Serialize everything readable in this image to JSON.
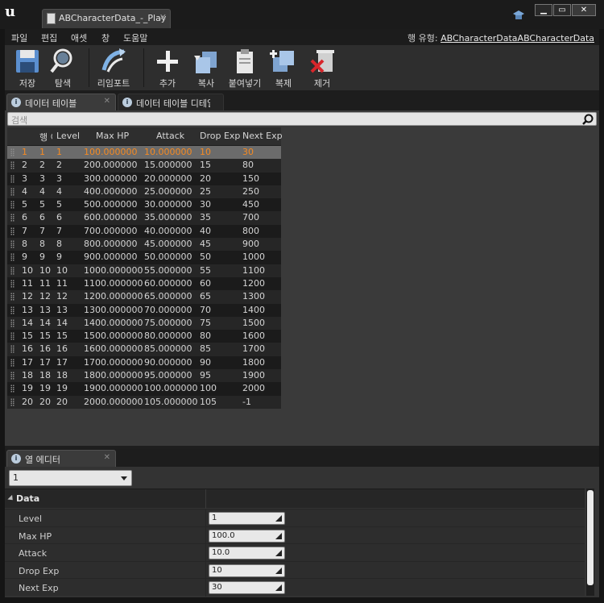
{
  "window": {
    "tab_title": "ABCharacterData_-_Play",
    "minimize": "▁",
    "maximize": "▭",
    "close": "✕"
  },
  "menu": {
    "items": [
      "파일",
      "편집",
      "애셋",
      "창",
      "도움말"
    ],
    "row_type_label": "행 유형:",
    "row_type_value": "ABCharacterDataABCharacterData"
  },
  "toolbar": {
    "buttons": [
      {
        "label": "저장",
        "icon": "save-icon"
      },
      {
        "label": "탐색",
        "icon": "browse-icon"
      },
      {
        "label": "리임포트",
        "icon": "reimport-icon"
      },
      {
        "label": "추가",
        "icon": "add-icon"
      },
      {
        "label": "복사",
        "icon": "copy-icon"
      },
      {
        "label": "붙여넣기",
        "icon": "paste-icon"
      },
      {
        "label": "복제",
        "icon": "duplicate-icon"
      },
      {
        "label": "제거",
        "icon": "remove-icon"
      }
    ]
  },
  "tabs": {
    "data_table": "데이터 테이블",
    "data_table_details": "데이터 테이블 디테일",
    "column_editor": "열 에디터"
  },
  "search": {
    "placeholder": "검색"
  },
  "table": {
    "columns": [
      "행 이름",
      "Level",
      "Max HP",
      "Attack",
      "Drop Exp",
      "Next Exp"
    ],
    "rows": [
      [
        "1",
        "1",
        "1",
        "100.000000",
        "10.000000",
        "10",
        "30"
      ],
      [
        "2",
        "2",
        "2",
        "200.000000",
        "15.000000",
        "15",
        "80"
      ],
      [
        "3",
        "3",
        "3",
        "300.000000",
        "20.000000",
        "20",
        "150"
      ],
      [
        "4",
        "4",
        "4",
        "400.000000",
        "25.000000",
        "25",
        "250"
      ],
      [
        "5",
        "5",
        "5",
        "500.000000",
        "30.000000",
        "30",
        "450"
      ],
      [
        "6",
        "6",
        "6",
        "600.000000",
        "35.000000",
        "35",
        "700"
      ],
      [
        "7",
        "7",
        "7",
        "700.000000",
        "40.000000",
        "40",
        "800"
      ],
      [
        "8",
        "8",
        "8",
        "800.000000",
        "45.000000",
        "45",
        "900"
      ],
      [
        "9",
        "9",
        "9",
        "900.000000",
        "50.000000",
        "50",
        "1000"
      ],
      [
        "10",
        "10",
        "10",
        "1000.000000",
        "55.000000",
        "55",
        "1100"
      ],
      [
        "11",
        "11",
        "11",
        "1100.000000",
        "60.000000",
        "60",
        "1200"
      ],
      [
        "12",
        "12",
        "12",
        "1200.000000",
        "65.000000",
        "65",
        "1300"
      ],
      [
        "13",
        "13",
        "13",
        "1300.000000",
        "70.000000",
        "70",
        "1400"
      ],
      [
        "14",
        "14",
        "14",
        "1400.000000",
        "75.000000",
        "75",
        "1500"
      ],
      [
        "15",
        "15",
        "15",
        "1500.000000",
        "80.000000",
        "80",
        "1600"
      ],
      [
        "16",
        "16",
        "16",
        "1600.000000",
        "85.000000",
        "85",
        "1700"
      ],
      [
        "17",
        "17",
        "17",
        "1700.000000",
        "90.000000",
        "90",
        "1800"
      ],
      [
        "18",
        "18",
        "18",
        "1800.000000",
        "95.000000",
        "95",
        "1900"
      ],
      [
        "19",
        "19",
        "19",
        "1900.000000",
        "100.000000",
        "100",
        "2000"
      ],
      [
        "20",
        "20",
        "20",
        "2000.000000",
        "105.000000",
        "105",
        "-1"
      ]
    ],
    "selected_row": 0
  },
  "column_editor": {
    "row_selector_value": "1",
    "category": "Data",
    "properties": [
      {
        "name": "Level",
        "value": "1"
      },
      {
        "name": "Max HP",
        "value": "100.0"
      },
      {
        "name": "Attack",
        "value": "10.0"
      },
      {
        "name": "Drop Exp",
        "value": "10"
      },
      {
        "name": "Next Exp",
        "value": "30"
      }
    ]
  },
  "colors": {
    "selected_row_text": "#f58a22",
    "panel_bg": "#3a3a3a"
  }
}
